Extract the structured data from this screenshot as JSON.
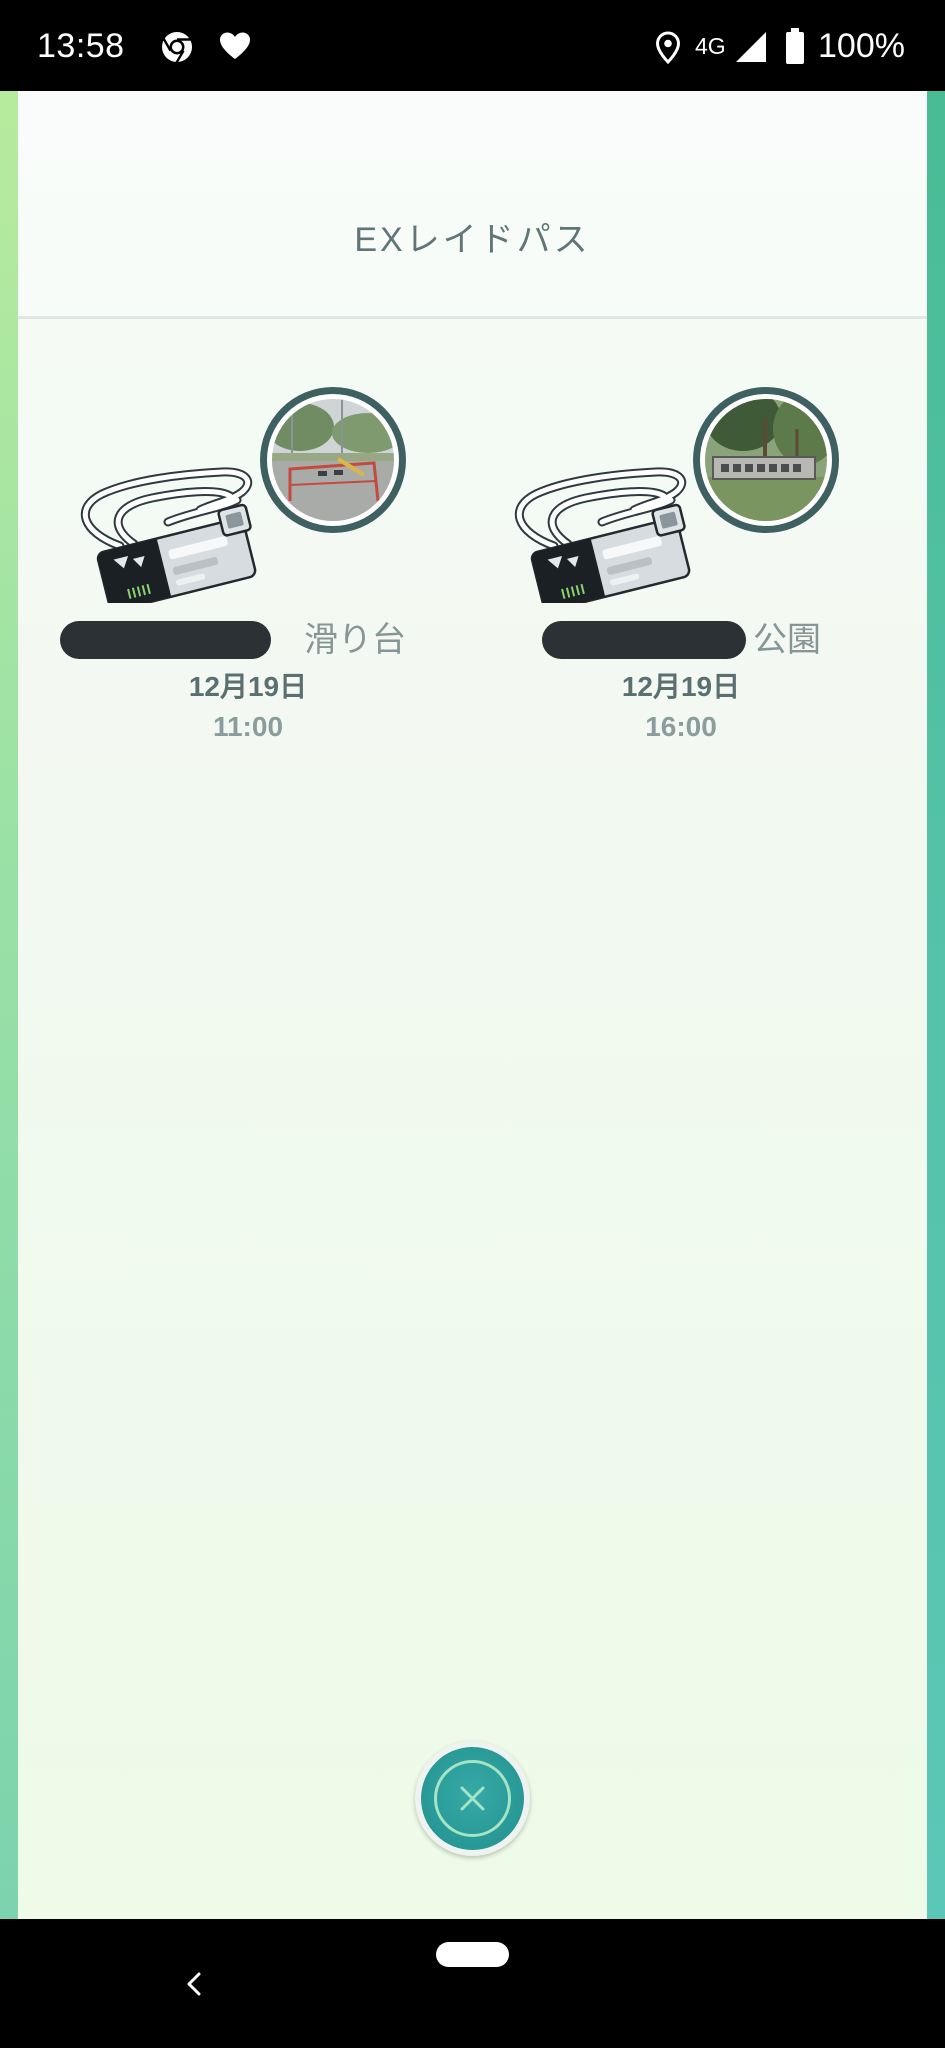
{
  "status_bar": {
    "time": "13:58",
    "network_type": "4G",
    "battery_level": "100%",
    "left_icons": [
      "chrome-icon",
      "heart-icon"
    ],
    "right_icons": [
      "location-icon",
      "signal-icon",
      "battery-icon"
    ]
  },
  "header": {
    "title": "EXレイドパス"
  },
  "passes": [
    {
      "gym_name_visible": "滑り台",
      "date": "12月19日",
      "time": "11:00",
      "icon": "ex-raid-pass-icon"
    },
    {
      "gym_name_visible": "公園",
      "date": "12月19日",
      "time": "16:00",
      "icon": "ex-raid-pass-icon"
    }
  ],
  "close_button": {
    "icon": "close-icon"
  },
  "nav_bar": {
    "icons": [
      "back-icon",
      "home-pill"
    ]
  },
  "colors": {
    "accent": "#2a9a98",
    "status_bar_bg": "#000000",
    "nav_bar_bg": "#000000",
    "title_text": "#5f7577",
    "date_text": "#5b6f71",
    "time_text": "#8b9c9c",
    "name_text": "#869696",
    "ring": "#3e6061",
    "redaction": "#2b3134"
  }
}
